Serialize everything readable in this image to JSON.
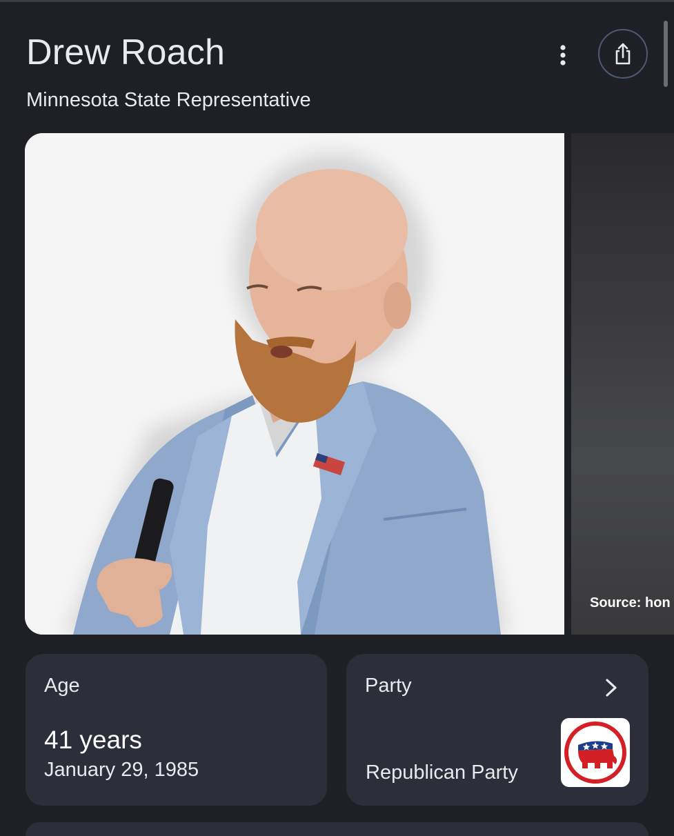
{
  "header": {
    "title": "Drew Roach",
    "subtitle": "Minnesota State Representative"
  },
  "actions": {
    "more_icon": "more-vert-icon",
    "share_icon": "share-icon"
  },
  "images": {
    "source_caption": "Source: hon"
  },
  "age_card": {
    "label": "Age",
    "value": "41 years",
    "date": "January 29, 1985"
  },
  "party_card": {
    "label": "Party",
    "value": "Republican Party",
    "chevron_icon": "chevron-right-icon",
    "logo_icon": "republican-elephant-logo"
  },
  "colors": {
    "background": "#1f2025",
    "card": "#2c2f3a",
    "text": "#e8eaed",
    "share_ring": "#4f5a72",
    "republican_red": "#d32027"
  }
}
